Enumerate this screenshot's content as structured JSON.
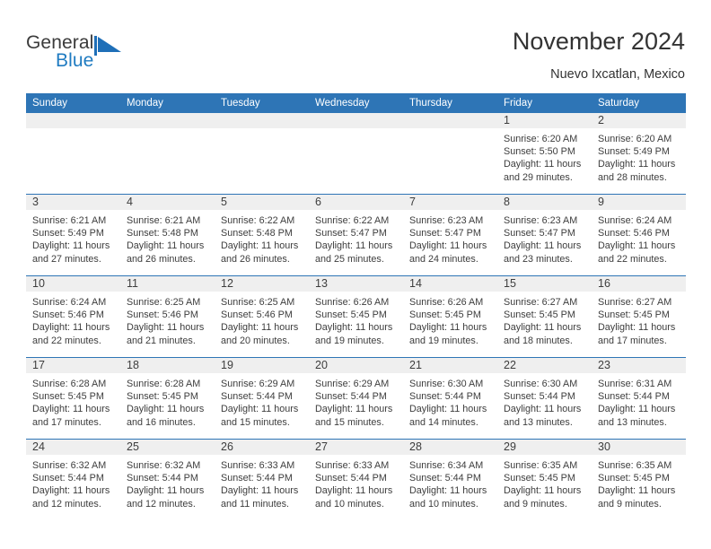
{
  "brand": {
    "name_part1": "General",
    "name_part2": "Blue",
    "logo_icon": "blue-triangle-flag-icon",
    "accent_color": "#1f7bc1"
  },
  "header": {
    "title": "November 2024",
    "subtitle": "Nuevo Ixcatlan, Mexico"
  },
  "theme": {
    "header_row_bg": "#2e75b6",
    "daynum_bg": "#efefef",
    "cell_bg": "#ffffff",
    "text_color": "#3d3d3d"
  },
  "calendar": {
    "weekday_headers": [
      "Sunday",
      "Monday",
      "Tuesday",
      "Wednesday",
      "Thursday",
      "Friday",
      "Saturday"
    ],
    "weeks": [
      [
        {
          "day": "",
          "blank": true
        },
        {
          "day": "",
          "blank": true
        },
        {
          "day": "",
          "blank": true
        },
        {
          "day": "",
          "blank": true
        },
        {
          "day": "",
          "blank": true
        },
        {
          "day": "1",
          "sunrise": "Sunrise: 6:20 AM",
          "sunset": "Sunset: 5:50 PM",
          "daylight": "Daylight: 11 hours and 29 minutes."
        },
        {
          "day": "2",
          "sunrise": "Sunrise: 6:20 AM",
          "sunset": "Sunset: 5:49 PM",
          "daylight": "Daylight: 11 hours and 28 minutes."
        }
      ],
      [
        {
          "day": "3",
          "sunrise": "Sunrise: 6:21 AM",
          "sunset": "Sunset: 5:49 PM",
          "daylight": "Daylight: 11 hours and 27 minutes."
        },
        {
          "day": "4",
          "sunrise": "Sunrise: 6:21 AM",
          "sunset": "Sunset: 5:48 PM",
          "daylight": "Daylight: 11 hours and 26 minutes."
        },
        {
          "day": "5",
          "sunrise": "Sunrise: 6:22 AM",
          "sunset": "Sunset: 5:48 PM",
          "daylight": "Daylight: 11 hours and 26 minutes."
        },
        {
          "day": "6",
          "sunrise": "Sunrise: 6:22 AM",
          "sunset": "Sunset: 5:47 PM",
          "daylight": "Daylight: 11 hours and 25 minutes."
        },
        {
          "day": "7",
          "sunrise": "Sunrise: 6:23 AM",
          "sunset": "Sunset: 5:47 PM",
          "daylight": "Daylight: 11 hours and 24 minutes."
        },
        {
          "day": "8",
          "sunrise": "Sunrise: 6:23 AM",
          "sunset": "Sunset: 5:47 PM",
          "daylight": "Daylight: 11 hours and 23 minutes."
        },
        {
          "day": "9",
          "sunrise": "Sunrise: 6:24 AM",
          "sunset": "Sunset: 5:46 PM",
          "daylight": "Daylight: 11 hours and 22 minutes."
        }
      ],
      [
        {
          "day": "10",
          "sunrise": "Sunrise: 6:24 AM",
          "sunset": "Sunset: 5:46 PM",
          "daylight": "Daylight: 11 hours and 22 minutes."
        },
        {
          "day": "11",
          "sunrise": "Sunrise: 6:25 AM",
          "sunset": "Sunset: 5:46 PM",
          "daylight": "Daylight: 11 hours and 21 minutes."
        },
        {
          "day": "12",
          "sunrise": "Sunrise: 6:25 AM",
          "sunset": "Sunset: 5:46 PM",
          "daylight": "Daylight: 11 hours and 20 minutes."
        },
        {
          "day": "13",
          "sunrise": "Sunrise: 6:26 AM",
          "sunset": "Sunset: 5:45 PM",
          "daylight": "Daylight: 11 hours and 19 minutes."
        },
        {
          "day": "14",
          "sunrise": "Sunrise: 6:26 AM",
          "sunset": "Sunset: 5:45 PM",
          "daylight": "Daylight: 11 hours and 19 minutes."
        },
        {
          "day": "15",
          "sunrise": "Sunrise: 6:27 AM",
          "sunset": "Sunset: 5:45 PM",
          "daylight": "Daylight: 11 hours and 18 minutes."
        },
        {
          "day": "16",
          "sunrise": "Sunrise: 6:27 AM",
          "sunset": "Sunset: 5:45 PM",
          "daylight": "Daylight: 11 hours and 17 minutes."
        }
      ],
      [
        {
          "day": "17",
          "sunrise": "Sunrise: 6:28 AM",
          "sunset": "Sunset: 5:45 PM",
          "daylight": "Daylight: 11 hours and 17 minutes."
        },
        {
          "day": "18",
          "sunrise": "Sunrise: 6:28 AM",
          "sunset": "Sunset: 5:45 PM",
          "daylight": "Daylight: 11 hours and 16 minutes."
        },
        {
          "day": "19",
          "sunrise": "Sunrise: 6:29 AM",
          "sunset": "Sunset: 5:44 PM",
          "daylight": "Daylight: 11 hours and 15 minutes."
        },
        {
          "day": "20",
          "sunrise": "Sunrise: 6:29 AM",
          "sunset": "Sunset: 5:44 PM",
          "daylight": "Daylight: 11 hours and 15 minutes."
        },
        {
          "day": "21",
          "sunrise": "Sunrise: 6:30 AM",
          "sunset": "Sunset: 5:44 PM",
          "daylight": "Daylight: 11 hours and 14 minutes."
        },
        {
          "day": "22",
          "sunrise": "Sunrise: 6:30 AM",
          "sunset": "Sunset: 5:44 PM",
          "daylight": "Daylight: 11 hours and 13 minutes."
        },
        {
          "day": "23",
          "sunrise": "Sunrise: 6:31 AM",
          "sunset": "Sunset: 5:44 PM",
          "daylight": "Daylight: 11 hours and 13 minutes."
        }
      ],
      [
        {
          "day": "24",
          "sunrise": "Sunrise: 6:32 AM",
          "sunset": "Sunset: 5:44 PM",
          "daylight": "Daylight: 11 hours and 12 minutes."
        },
        {
          "day": "25",
          "sunrise": "Sunrise: 6:32 AM",
          "sunset": "Sunset: 5:44 PM",
          "daylight": "Daylight: 11 hours and 12 minutes."
        },
        {
          "day": "26",
          "sunrise": "Sunrise: 6:33 AM",
          "sunset": "Sunset: 5:44 PM",
          "daylight": "Daylight: 11 hours and 11 minutes."
        },
        {
          "day": "27",
          "sunrise": "Sunrise: 6:33 AM",
          "sunset": "Sunset: 5:44 PM",
          "daylight": "Daylight: 11 hours and 10 minutes."
        },
        {
          "day": "28",
          "sunrise": "Sunrise: 6:34 AM",
          "sunset": "Sunset: 5:44 PM",
          "daylight": "Daylight: 11 hours and 10 minutes."
        },
        {
          "day": "29",
          "sunrise": "Sunrise: 6:35 AM",
          "sunset": "Sunset: 5:45 PM",
          "daylight": "Daylight: 11 hours and 9 minutes."
        },
        {
          "day": "30",
          "sunrise": "Sunrise: 6:35 AM",
          "sunset": "Sunset: 5:45 PM",
          "daylight": "Daylight: 11 hours and 9 minutes."
        }
      ]
    ]
  }
}
